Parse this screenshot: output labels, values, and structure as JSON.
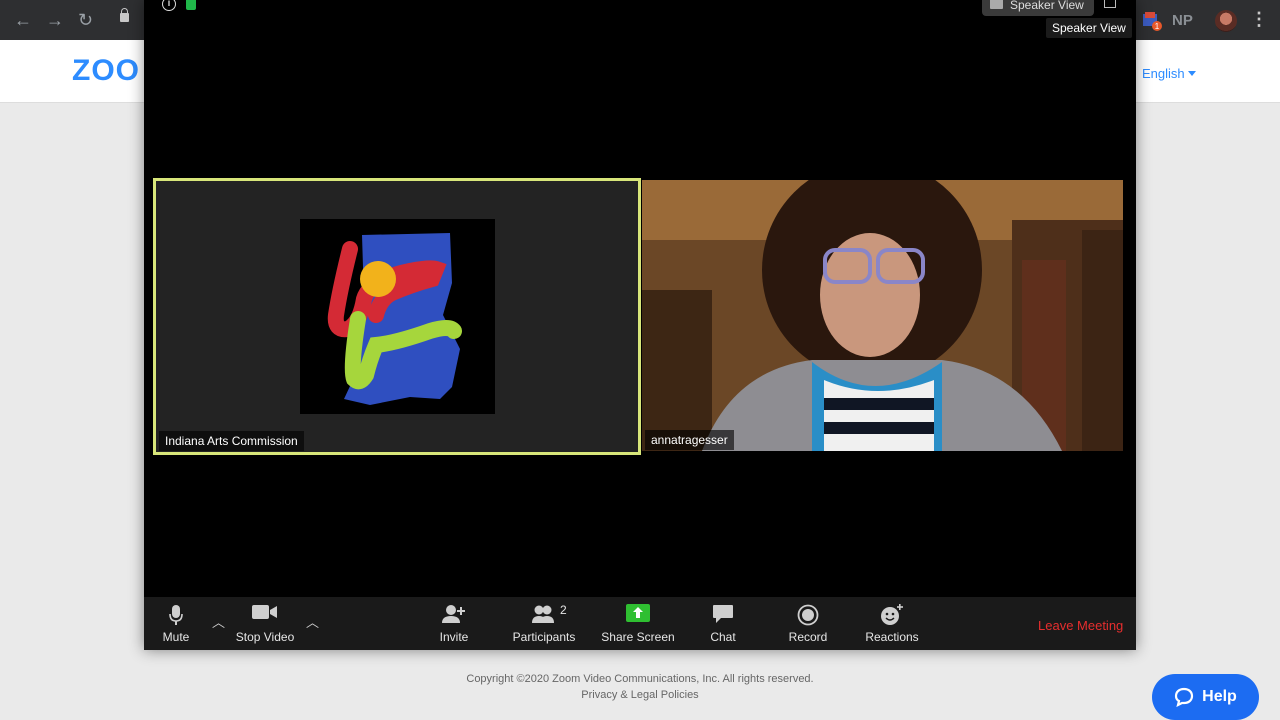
{
  "browser": {
    "back": "←",
    "forward": "→",
    "reload": "↻",
    "ext_badge": "1",
    "np_label": "NP",
    "menu": "⋮"
  },
  "site": {
    "logo": "ZOO",
    "language": "English",
    "copyright": "Copyright ©2020 Zoom Video Communications, Inc. All rights reserved.",
    "privacy": "Privacy & Legal Policies",
    "help_label": "Help"
  },
  "meeting": {
    "view_button": "Speaker View",
    "tooltip": "Speaker View",
    "participants": [
      {
        "name": "Indiana Arts Commission",
        "active_speaker": true
      },
      {
        "name": "annatragesser",
        "active_speaker": false
      }
    ],
    "toolbar": {
      "mute": "Mute",
      "stop_video": "Stop Video",
      "invite": "Invite",
      "participants": "Participants",
      "participant_count": "2",
      "share_screen": "Share Screen",
      "chat": "Chat",
      "record": "Record",
      "reactions": "Reactions",
      "leave": "Leave Meeting"
    }
  },
  "colors": {
    "accent": "#2d8cff",
    "active_speaker_border": "#d8e67a",
    "share_green": "#2fbf31",
    "leave_red": "#e62e2e",
    "help_blue": "#1c6cf2"
  }
}
